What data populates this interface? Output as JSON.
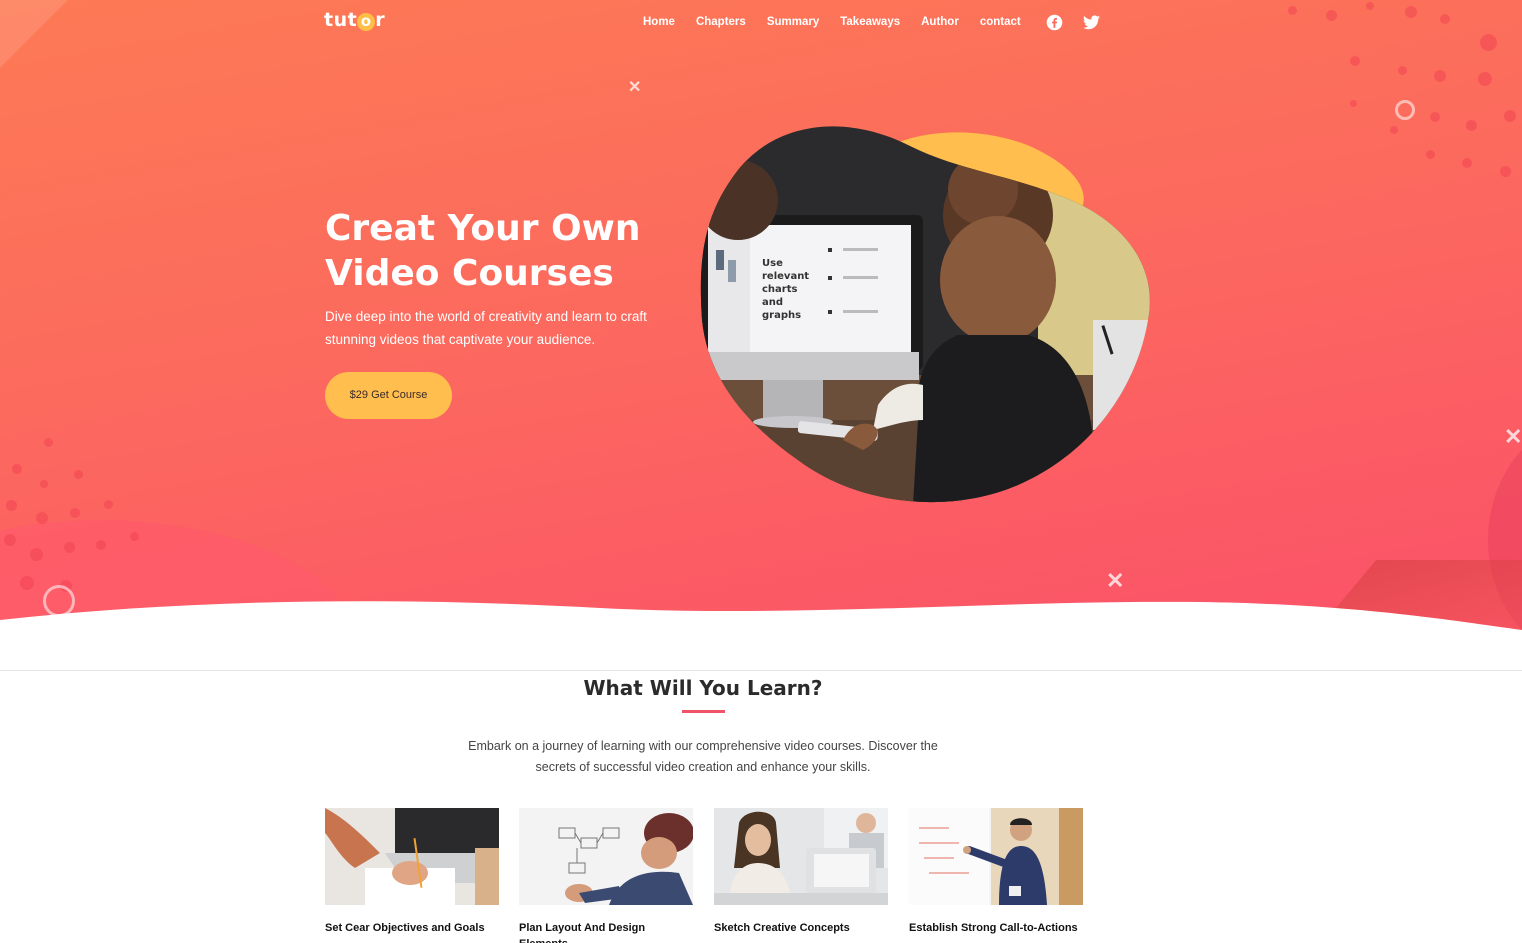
{
  "brand": {
    "logo_text_prefix": "tut",
    "logo_text_o": "o",
    "logo_text_suffix": "r",
    "accent": "#ffbe45"
  },
  "nav": {
    "items": [
      "Home",
      "Chapters",
      "Summary",
      "Takeaways",
      "Author",
      "contact"
    ],
    "social": [
      "facebook-icon",
      "twitter-icon"
    ]
  },
  "hero": {
    "title_line1": "Creat Your Own",
    "title_line2": "Video Courses",
    "subtitle": "Dive deep into the world of creativity and learn to craft stunning videos that captivate your audience.",
    "cta_label": "$29 Get Course",
    "screen_text": [
      "Use",
      "relevant",
      "charts",
      "and",
      "graphs"
    ],
    "colors": {
      "gradient_start": "#fd7a55",
      "gradient_end": "#fb5169",
      "cta": "#ffbe4d"
    }
  },
  "learn": {
    "title": "What Will You Learn?",
    "description": "Embark on a journey of learning with our comprehensive video courses. Discover the secrets of successful video creation and enhance your skills.",
    "underline_color": "#f05365",
    "cards": [
      {
        "title": "Set Cear Objectives and Goals"
      },
      {
        "title": "Plan Layout And Design Elements"
      },
      {
        "title": "Sketch Creative Concepts"
      },
      {
        "title": "Establish Strong Call-to-Actions"
      }
    ]
  }
}
